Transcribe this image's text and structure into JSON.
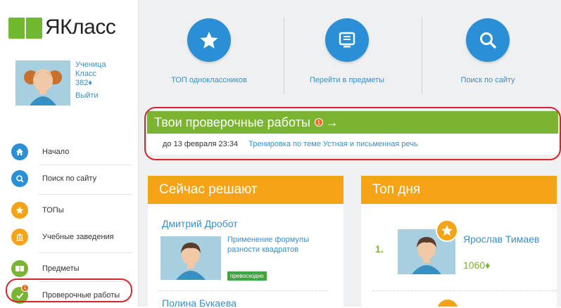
{
  "logo": {
    "text": "ЯКласс"
  },
  "profile": {
    "role": "Ученица",
    "klass": "Класс",
    "points": "382♦",
    "logout": "Выйти"
  },
  "nav": {
    "items": [
      {
        "label": "Начало",
        "icon": "home-icon",
        "color": "#2a8fd4"
      },
      {
        "label": "Поиск по сайту",
        "icon": "search-icon",
        "color": "#2a8fd4"
      },
      {
        "label": "ТОПы",
        "icon": "star-icon",
        "color": "#f5a317"
      },
      {
        "label": "Учебные заведения",
        "icon": "institution-icon",
        "color": "#f5a317"
      },
      {
        "label": "Предметы",
        "icon": "book-icon",
        "color": "#7bb431"
      },
      {
        "label": "Проверочные работы",
        "icon": "check-icon",
        "color": "#7bb431",
        "badge": "1"
      }
    ]
  },
  "quick": {
    "items": [
      {
        "label": "ТОП одноклассников",
        "icon": "star-icon"
      },
      {
        "label": "Перейти в предметы",
        "icon": "monitor-icon"
      },
      {
        "label": "Поиск по сайту",
        "icon": "search-icon"
      }
    ]
  },
  "tests": {
    "title": "Твои проверочные работы",
    "count": "1",
    "arrow": "→",
    "deadline": "до 13 февраля 23:34",
    "task": "Тренировка по теме Устная и письменная речь"
  },
  "solving": {
    "title": "Сейчас решают",
    "name": "Дмитрий Дробот",
    "task": "Применение формулы разности квадратов",
    "grade": "превосходно",
    "name2": "Полина Букаева"
  },
  "top": {
    "title": "Топ дня",
    "rank": "1.",
    "name": "Ярослав Тимаев",
    "score": "1060♦"
  },
  "colors": {
    "blue": "#2a8fd4",
    "green": "#7bb431",
    "orange": "#f5a317",
    "highlight": "#d9232d"
  }
}
